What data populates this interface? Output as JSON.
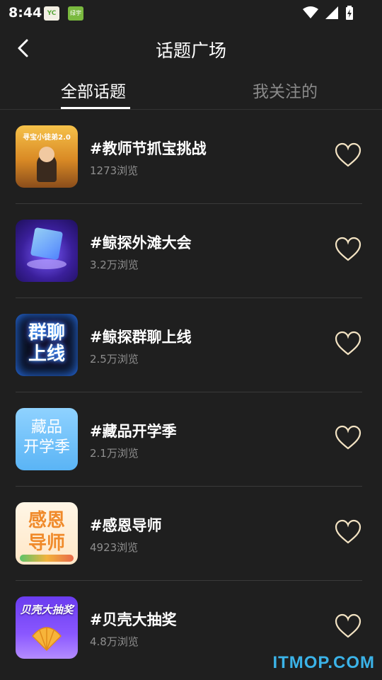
{
  "status_bar": {
    "time": "8:44",
    "app_icon1_text": "YC",
    "app_icon2_text": "绿宇"
  },
  "header": {
    "title": "话题广场"
  },
  "tabs": [
    {
      "label": "全部话题",
      "active": true
    },
    {
      "label": "我关注的",
      "active": false
    }
  ],
  "topics": [
    {
      "title": "#教师节抓宝挑战",
      "views": "1273浏览",
      "thumb_text": "寻宝小徒弟2.0"
    },
    {
      "title": "#鲸探外滩大会",
      "views": "3.2万浏览",
      "thumb_text": ""
    },
    {
      "title": "#鲸探群聊上线",
      "views": "2.5万浏览",
      "thumb_text": "群聊上线"
    },
    {
      "title": "#藏品开学季",
      "views": "2.1万浏览",
      "thumb_text": "藏品开学季"
    },
    {
      "title": "#感恩导师",
      "views": "4923浏览",
      "thumb_text": "感恩导师"
    },
    {
      "title": "#贝壳大抽奖",
      "views": "4.8万浏览",
      "thumb_text": "贝壳大抽奖"
    }
  ],
  "colors": {
    "background": "#1f1f1f",
    "heart_outline": "#f3e3c3",
    "secondary_text": "#8e8e8e",
    "watermark": "#3bb3e8"
  },
  "icons": {
    "back": "chevron-left-icon",
    "favorite": "heart-outline-icon"
  },
  "watermark": "ITMOP.COM"
}
